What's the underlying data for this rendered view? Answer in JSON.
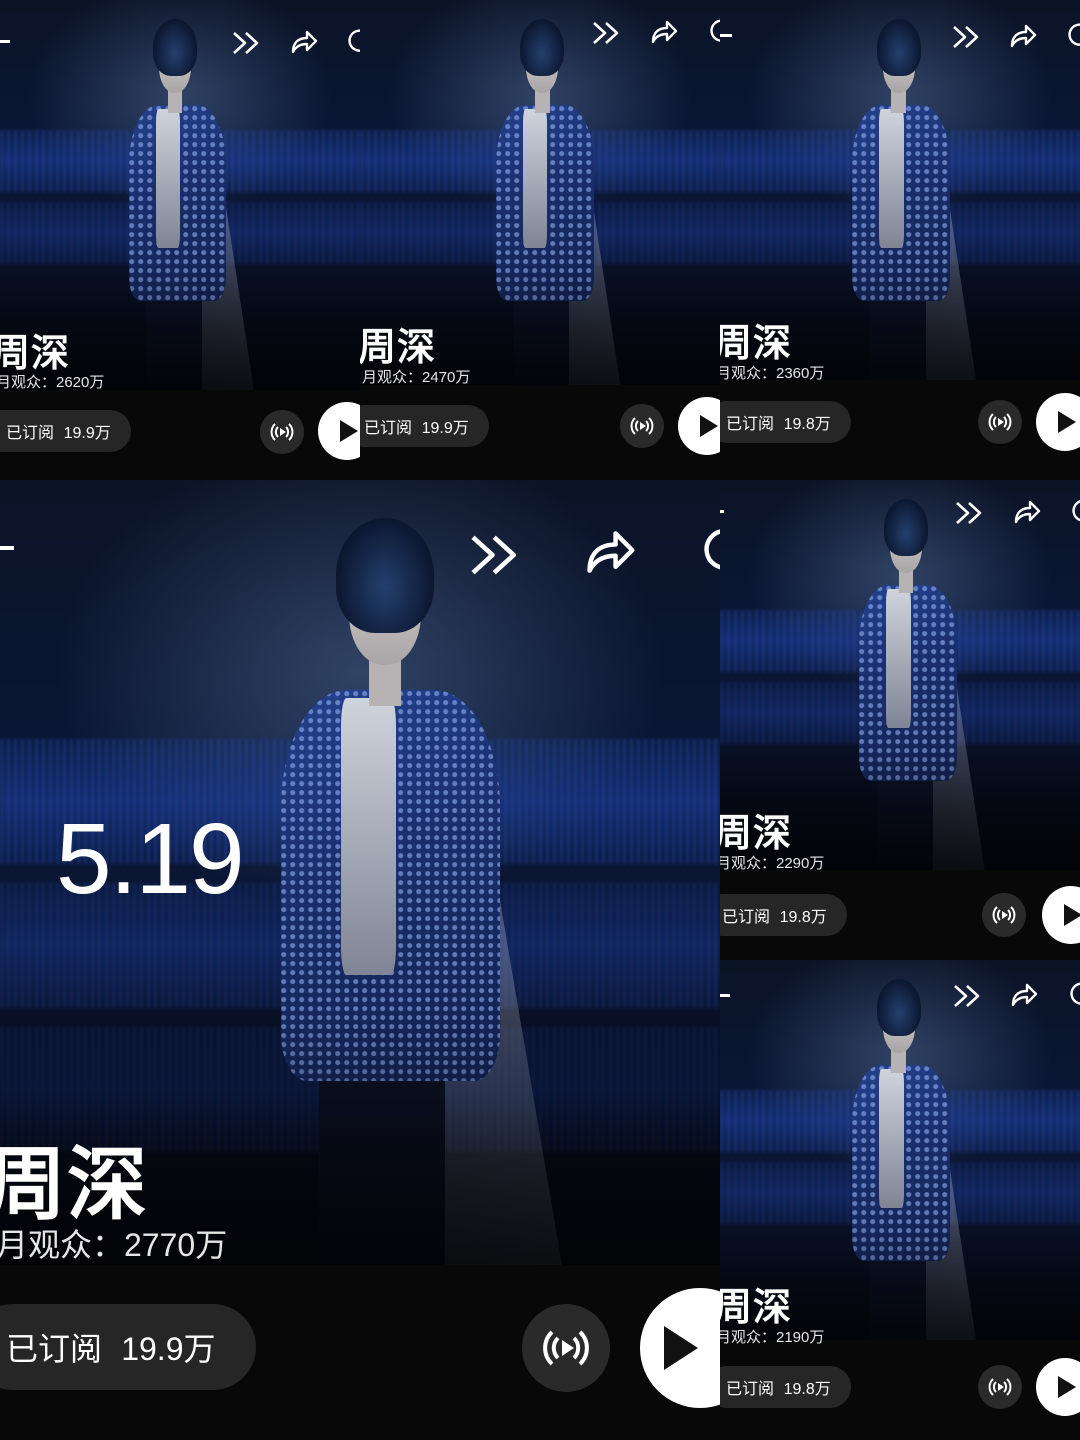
{
  "panels": [
    {
      "name": "周深",
      "viewers": "月观众：2620万",
      "subscribed_label": "已订阅",
      "subscribed_count": "19.9万"
    },
    {
      "name": "周深",
      "viewers": "月观众：2470万",
      "subscribed_label": "已订阅",
      "subscribed_count": "19.9万"
    },
    {
      "name": "周深",
      "viewers": "月观众：2360万",
      "subscribed_label": "已订阅",
      "subscribed_count": "19.8万"
    },
    {
      "name": "周深",
      "viewers": "月观众：2770万",
      "subscribed_label": "已订阅",
      "subscribed_count": "19.9万",
      "date": "5.19"
    },
    {
      "name": "周深",
      "viewers": "月观众：2290万",
      "subscribed_label": "已订阅",
      "subscribed_count": "19.8万"
    },
    {
      "name": "周深",
      "viewers": "月观众：2190万",
      "subscribed_label": "已订阅",
      "subscribed_count": "19.8万"
    }
  ],
  "icons": {
    "skip": "fast-forward-icon",
    "share": "share-icon",
    "refresh": "refresh-icon",
    "radio": "radio-broadcast-icon",
    "play": "play-icon",
    "back": "back-dash-icon"
  },
  "colors": {
    "background": "#000000",
    "pill": "#262626",
    "play_button": "#ffffff",
    "accent_blue": "#1f3a8a"
  }
}
